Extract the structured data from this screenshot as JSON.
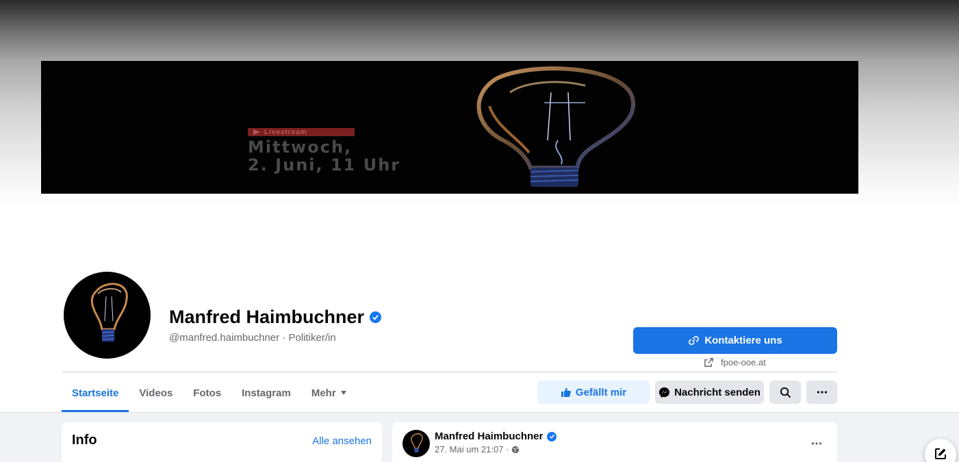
{
  "cover": {
    "badge": "Livestream",
    "line1": "Mittwoch,",
    "line2": "2. Juni, 11 Uhr"
  },
  "profile": {
    "name": "Manfred Haimbuchner",
    "handle_line": "@manfred.haimbuchner · Politiker/in"
  },
  "contact": {
    "button_label": "Kontaktiere uns",
    "website": "fpoe-ooe.at"
  },
  "tabs": [
    {
      "label": "Startseite",
      "active": true
    },
    {
      "label": "Videos",
      "active": false
    },
    {
      "label": "Fotos",
      "active": false
    },
    {
      "label": "Instagram",
      "active": false
    },
    {
      "label": "Mehr",
      "active": false
    }
  ],
  "actions": {
    "like_label": "Gefällt mir",
    "message_label": "Nachricht senden",
    "search_icon": "search-icon",
    "more_icon": "more-icon"
  },
  "info_card": {
    "title": "Info",
    "link": "Alle ansehen"
  },
  "post": {
    "author": "Manfred Haimbuchner",
    "date": "27. Mai um 21:07 ·"
  },
  "colors": {
    "accent": "#1b74e4",
    "verified": "#1877f2",
    "like_bg": "#e7f3ff",
    "button_bg": "#e4e6eb",
    "feed_bg": "#f0f2f5"
  }
}
